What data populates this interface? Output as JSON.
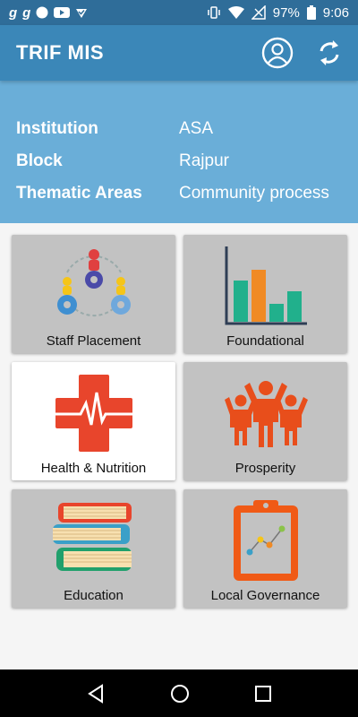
{
  "status_bar": {
    "left_icons": [
      "g-icon",
      "g-icon",
      "circle-icon",
      "youtube-icon",
      "check-icon"
    ],
    "battery": "97%",
    "time": "9:06"
  },
  "app_bar": {
    "title": "TRIF MIS"
  },
  "info": [
    {
      "label": "Institution",
      "value": "ASA"
    },
    {
      "label": "Block",
      "value": "Rajpur"
    },
    {
      "label": "Thematic Areas",
      "value": "Community process"
    }
  ],
  "tiles": [
    {
      "label": "Staff Placement",
      "icon": "team-gears-icon"
    },
    {
      "label": "Foundational",
      "icon": "bar-chart-icon"
    },
    {
      "label": "Health & Nutrition",
      "icon": "medical-cross-icon"
    },
    {
      "label": "Prosperity",
      "icon": "people-celebrating-icon"
    },
    {
      "label": "Education",
      "icon": "books-icon"
    },
    {
      "label": "Local Governance",
      "icon": "clipboard-chart-icon"
    }
  ],
  "colors": {
    "status_bar": "#2f6d99",
    "app_bar": "#3b87b8",
    "info_panel": "#6aaed8",
    "tile_bg": "#c2c2c2"
  }
}
